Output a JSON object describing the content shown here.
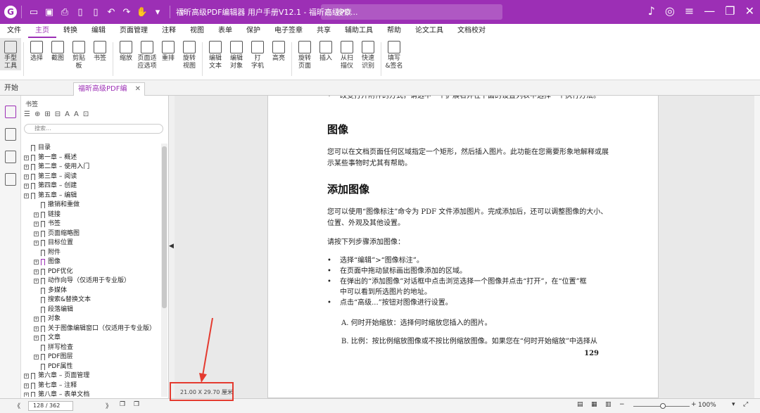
{
  "titlebar": {
    "title": "福昕高级PDF编辑器 用户手册V12.1 - 福昕高级PD...",
    "search_placeholder": "搜索"
  },
  "menubar": [
    "文件",
    "主页",
    "转换",
    "编辑",
    "页面管理",
    "注释",
    "视图",
    "表单",
    "保护",
    "电子签章",
    "共享",
    "辅助工具",
    "帮助",
    "论文工具",
    "文档校对"
  ],
  "ribbon": [
    {
      "l1": "手型",
      "l2": "工具"
    },
    {
      "l1": "选择",
      "l2": ""
    },
    {
      "l1": "截图",
      "l2": ""
    },
    {
      "l1": "剪贴",
      "l2": "板"
    },
    {
      "l1": "书签",
      "l2": ""
    },
    {
      "l1": "缩放",
      "l2": ""
    },
    {
      "l1": "页面适",
      "l2": "应选项"
    },
    {
      "l1": "重排",
      "l2": ""
    },
    {
      "l1": "旋转",
      "l2": "视图"
    },
    {
      "l1": "编辑",
      "l2": "文本"
    },
    {
      "l1": "编辑",
      "l2": "对象"
    },
    {
      "l1": "打",
      "l2": "字机"
    },
    {
      "l1": "高亮",
      "l2": ""
    },
    {
      "l1": "旋转",
      "l2": "页面"
    },
    {
      "l1": "插入",
      "l2": ""
    },
    {
      "l1": "从扫",
      "l2": "描仪"
    },
    {
      "l1": "快速",
      "l2": "识别"
    },
    {
      "l1": "填写",
      "l2": "&签名"
    }
  ],
  "tabs": {
    "start": "开始",
    "doc": "福昕高级PDF编辑..."
  },
  "panel": {
    "title": "书签",
    "search_placeholder": "搜索..."
  },
  "tree": [
    {
      "label": "目录",
      "level": 0,
      "exp": false
    },
    {
      "label": "第一章 – 概述",
      "level": 0,
      "exp": true
    },
    {
      "label": "第二章 – 使用入门",
      "level": 0,
      "exp": true
    },
    {
      "label": "第三章 – 阅读",
      "level": 0,
      "exp": true
    },
    {
      "label": "第四章 – 创建",
      "level": 0,
      "exp": true
    },
    {
      "label": "第五章 – 编辑",
      "level": 0,
      "exp": true
    },
    {
      "label": "撤销和重做",
      "level": 1,
      "exp": false
    },
    {
      "label": "链接",
      "level": 1,
      "exp": true
    },
    {
      "label": "书签",
      "level": 1,
      "exp": true
    },
    {
      "label": "页面缩略图",
      "level": 1,
      "exp": true
    },
    {
      "label": "目标位置",
      "level": 1,
      "exp": true
    },
    {
      "label": "附件",
      "level": 1,
      "exp": false
    },
    {
      "label": "图像",
      "level": 1,
      "exp": true,
      "active": true
    },
    {
      "label": "PDF优化",
      "level": 1,
      "exp": true
    },
    {
      "label": "动作向导（仅适用于专业版）",
      "level": 1,
      "exp": true
    },
    {
      "label": "多媒体",
      "level": 1,
      "exp": false
    },
    {
      "label": "搜索&替换文本",
      "level": 1,
      "exp": false
    },
    {
      "label": "段落编辑",
      "level": 1,
      "exp": false
    },
    {
      "label": "对象",
      "level": 1,
      "exp": true
    },
    {
      "label": "关于图像编辑窗口（仅适用于专业版）",
      "level": 1,
      "exp": true
    },
    {
      "label": "文章",
      "level": 1,
      "exp": true
    },
    {
      "label": "拼写检查",
      "level": 1,
      "exp": false
    },
    {
      "label": "PDF图层",
      "level": 1,
      "exp": true
    },
    {
      "label": "PDF属性",
      "level": 1,
      "exp": false
    },
    {
      "label": "第六章 – 页面管理",
      "level": 0,
      "exp": true
    },
    {
      "label": "第七章 – 注释",
      "level": 0,
      "exp": true
    },
    {
      "label": "第八章 – 表单文档",
      "level": 0,
      "exp": true
    }
  ],
  "page": {
    "top_line": "改变打开附件的方式，请选中一个扩展名并在下面的设置列表中选择一个执行方法。",
    "h_image": "图像",
    "p1a": "您可以在文档页面任何区域指定一个矩形，然后插入图片。此功能在您需要形象地解释或展",
    "p1b": "示某些事物时尤其有帮助。",
    "h_add": "添加图像",
    "p2a": "您可以使用“图像标注”命令为 PDF 文件添加图片。完成添加后，还可以调整图像的大小、",
    "p2b": "位置、外观及其他设置。",
    "p3": "请按下列步骤添加图像：",
    "b1": "选择“编辑”>“图像标注”。",
    "b2": "在页面中拖动鼠标画出图像添加的区域。",
    "b3a": "在弹出的“添加图像”对话框中点击浏览选择一个图像并点击“打开”，在“位置”框",
    "b3b": "中可以看到所选图片的地址。",
    "b4": "点击“高级...”按钮对图像进行设置。",
    "sA": "A. 何时开始缩放：选择何时缩放您插入的图片。",
    "sB": "B. 比例：按比例缩放图像或不按比例缩放图像。如果您在“何时开始缩放”中选择从",
    "page_number": "129"
  },
  "status": {
    "pager": "128 / 362",
    "page_size": "21.00 X 29.70 厘米",
    "zoom": "100%"
  },
  "colors": {
    "brand": "#9c2fb5",
    "annotation": "#e43a2f"
  }
}
